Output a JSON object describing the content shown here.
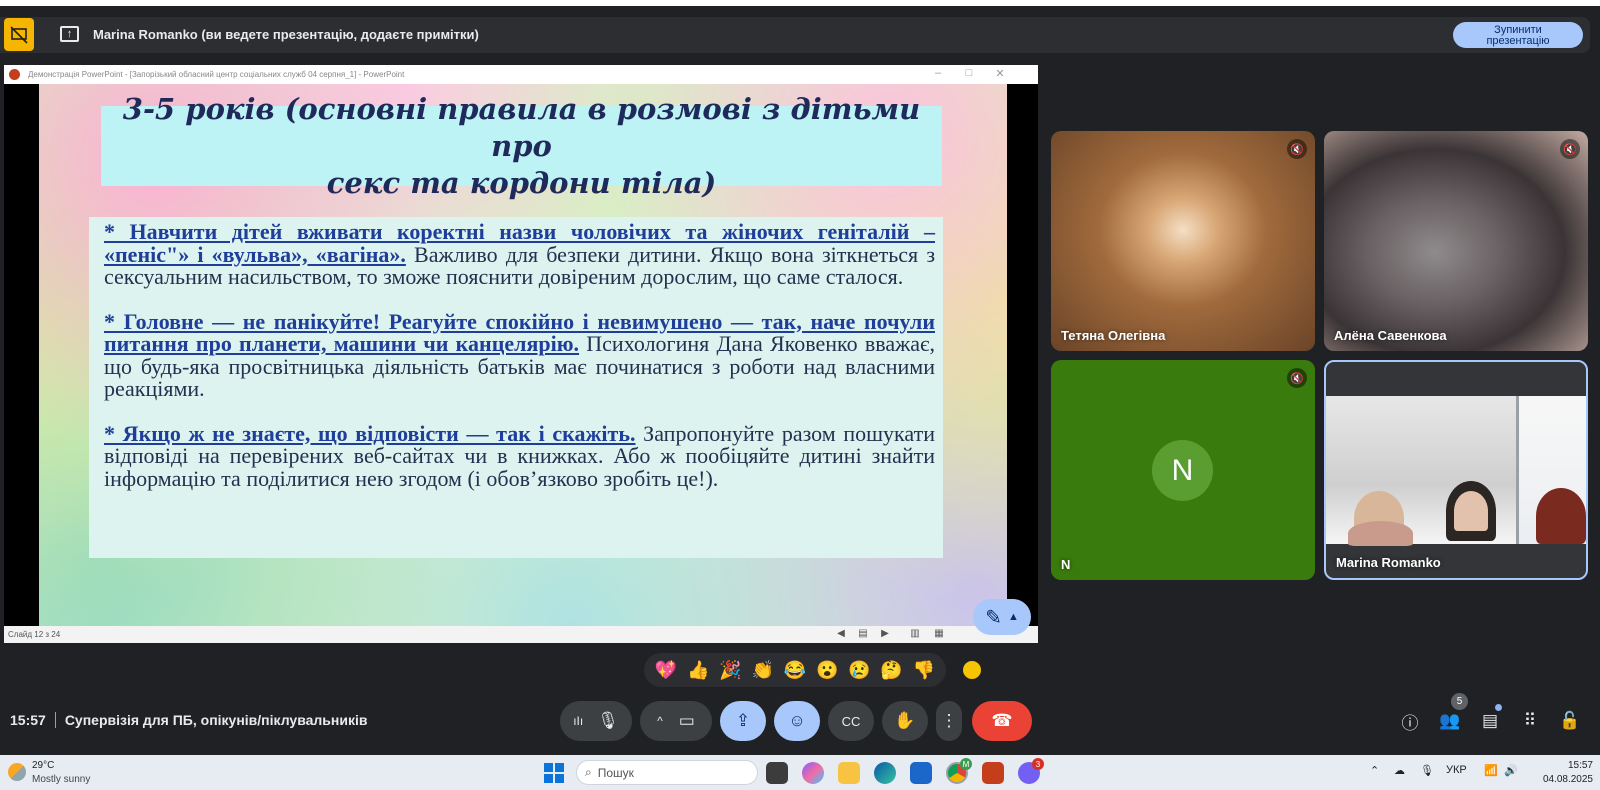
{
  "presenting_bar": {
    "text": "Marina Romanko (ви ведете презентацію, додаєте примітки)",
    "stop_button_line1": "Зупинити",
    "stop_button_line2": "презентацію"
  },
  "ppt_window": {
    "title": "Демонстрація PowerPoint - [Запорізький обласний центр соціальних служб 04 серпня_1] - PowerPoint",
    "status": "Слайд 12 з 24"
  },
  "slide": {
    "title_line1": "3-5 років (основні правила в розмові з дітьми про",
    "title_line2": "секс та кордони тіла)",
    "para1_bold": "* Навчити дітей вживати коректні назви чоловічих та жіночих геніталій – «пеніс\"» і «вульва», «вагіна».",
    "para1_rest": " Важливо для безпеки дитини. Якщо вона зіткнеться з сексуальним насильством, то зможе пояснити довіреним дорослим, що саме сталося.",
    "para2_bold": "* Головне — не панікуйте! Реагуйте спокійно і невимушено — так, наче почули питання про планети, машини чи канцелярію.",
    "para2_rest": " Психологиня Дана Яковенко вважає, що будь-яка просвітницька діяльність батьків має починатися з роботи над власними реакціями.",
    "para3_bold": "* Якщо ж не знаєте, що відповісти — так і скажіть.",
    "para3_rest": " Запропонуйте разом пошукати відповіді на перевірених веб-сайтах чи в книжках. Або ж пообіцяйте дитині знайти інформацію та поділитися нею згодом (і обов’язково зробіть це!)."
  },
  "participants": [
    {
      "name": "Тетяна Олегівна",
      "muted": true
    },
    {
      "name": "Алёна Савенкова",
      "muted": true
    },
    {
      "name": "N",
      "avatar_letter": "N",
      "muted": true
    },
    {
      "name": "Marina Romanko",
      "muted": false
    }
  ],
  "reactions": [
    "💖",
    "👍",
    "🎉",
    "👏",
    "😂",
    "😮",
    "😢",
    "🤔",
    "👎"
  ],
  "meeting": {
    "time": "15:57",
    "title": "Супервізія для ПБ, опікунів/піклувальників",
    "people_count": "5"
  },
  "taskbar": {
    "temperature": "29°C",
    "weather": "Mostly sunny",
    "search_placeholder": "Пошук",
    "language": "УКР",
    "time": "15:57",
    "date": "04.08.2025",
    "badge_chrome": "M",
    "badge_viber": "3"
  },
  "colors": {
    "accent_blue": "#a8c7fa",
    "end_call_red": "#ea4335",
    "present_badge": "#f6b500",
    "slide_link": "#1f3e99"
  }
}
